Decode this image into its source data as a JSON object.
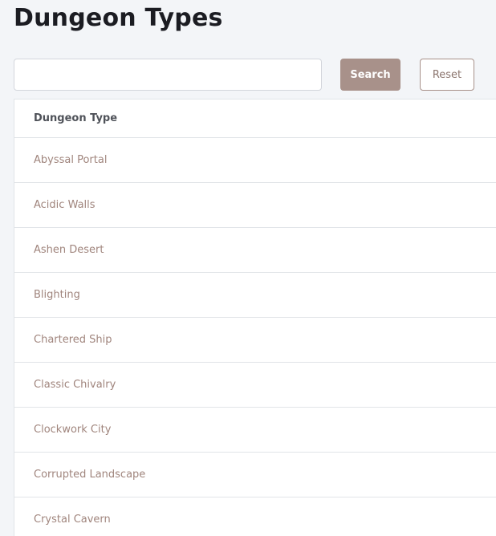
{
  "page": {
    "title": "Dungeon Types"
  },
  "search": {
    "value": "",
    "placeholder": "",
    "search_label": "Search",
    "reset_label": "Reset"
  },
  "table": {
    "header": "Dungeon Type",
    "rows": [
      "Abyssal Portal",
      "Acidic Walls",
      "Ashen Desert",
      "Blighting",
      "Chartered Ship",
      "Classic Chivalry",
      "Clockwork City",
      "Corrupted Landscape",
      "Crystal Cavern"
    ]
  },
  "colors": {
    "accent": "#a8918a",
    "row_text": "#a0857d",
    "background": "#f3f5f8"
  }
}
